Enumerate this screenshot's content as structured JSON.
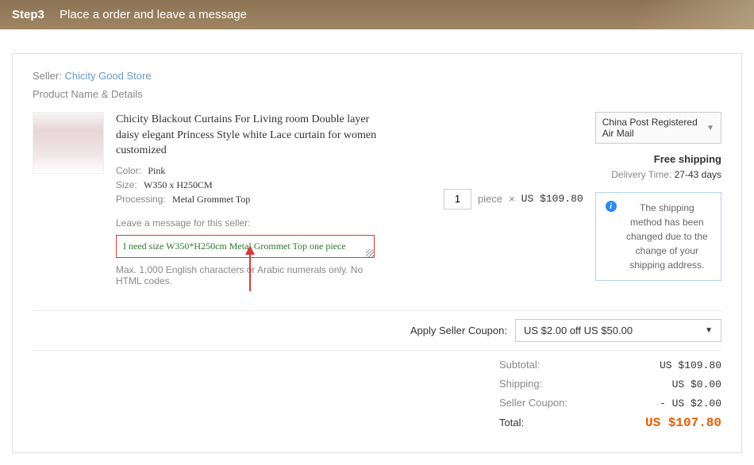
{
  "step": {
    "num": "Step3",
    "title": "Place a order and leave a message"
  },
  "seller": {
    "label": "Seller:",
    "name": "Chicity Good Store"
  },
  "details_label": "Product Name & Details",
  "product": {
    "title": "Chicity Blackout Curtains For Living room Double layer daisy elegant Princess Style white Lace curtain for women customized",
    "color_label": "Color:",
    "color": "Pink",
    "size_label": "Size:",
    "size": "W350 x H250CM",
    "proc_label": "Processing:",
    "proc": "Metal Grommet Top"
  },
  "message": {
    "label": "Leave a message for this seller:",
    "value": "I need size W350*H250cm Metal Grommet Top one piece",
    "hint": "Max. 1,000 English characters or Arabic numerals only. No HTML codes."
  },
  "qty": {
    "value": "1",
    "unit": "piece",
    "times": "×",
    "price": "US $109.80"
  },
  "shipping": {
    "method": "China Post Registered Air Mail",
    "free": "Free shipping",
    "delivery_label": "Delivery Time:",
    "delivery_days": "27-43 days",
    "info": "The shipping method has been changed due to the change of your shipping address."
  },
  "coupon": {
    "label": "Apply Seller Coupon:",
    "selected": "US $2.00 off US $50.00"
  },
  "totals": {
    "subtotal_label": "Subtotal:",
    "subtotal": "US $109.80",
    "shipping_label": "Shipping:",
    "shipping": "US $0.00",
    "coupon_label": "Seller Coupon:",
    "coupon": "- US $2.00",
    "total_label": "Total:",
    "total": "US $107.80"
  }
}
